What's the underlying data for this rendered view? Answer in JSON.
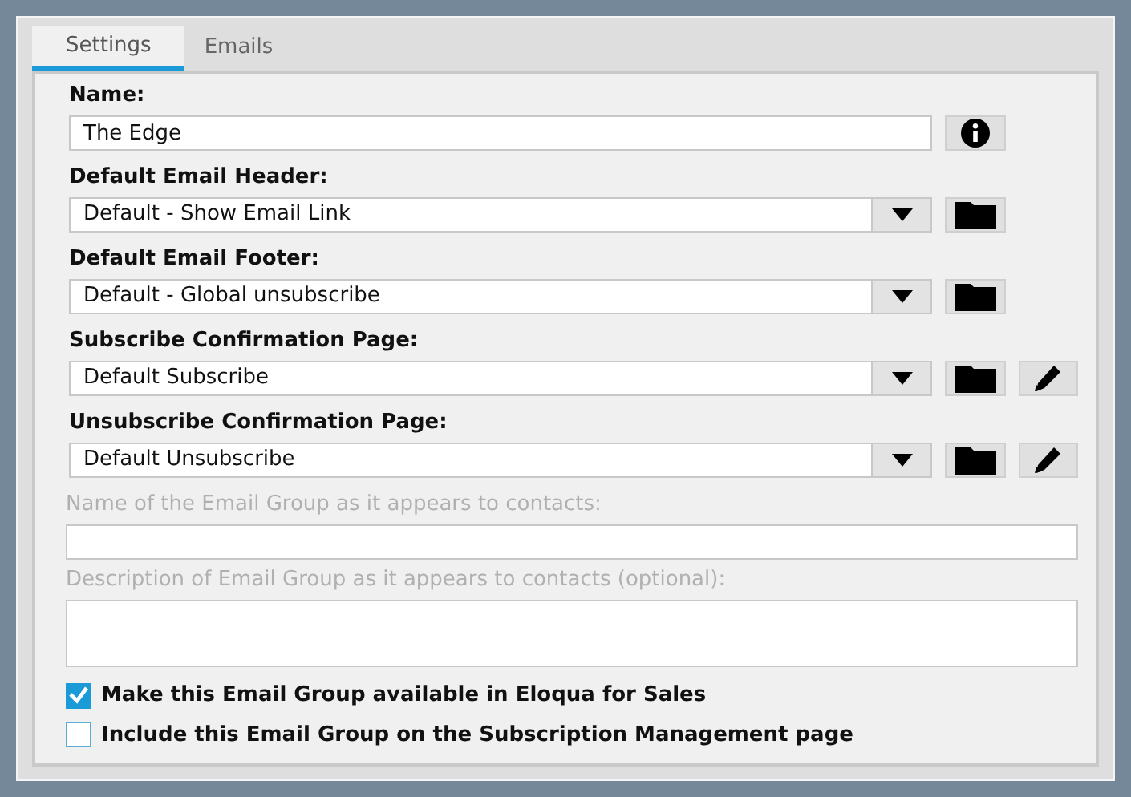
{
  "tabs": [
    {
      "label": "Settings",
      "selected": true
    },
    {
      "label": "Emails",
      "selected": false
    }
  ],
  "fields": [
    {
      "kind": "text",
      "label": "Name:",
      "value": "The Edge",
      "disabled": false,
      "buttons": [
        {
          "kind": "info"
        }
      ]
    },
    {
      "kind": "select",
      "label": "Default Email Header:",
      "value": "Default - Show Email Link",
      "disabled": false,
      "buttons": [
        {
          "kind": "folder"
        }
      ]
    },
    {
      "kind": "select",
      "label": "Default Email Footer:",
      "value": "Default - Global unsubscribe",
      "disabled": false,
      "buttons": [
        {
          "kind": "folder"
        }
      ]
    },
    {
      "kind": "select",
      "label": "Subscribe Confirmation Page:",
      "value": "Default Subscribe",
      "disabled": false,
      "buttons": [
        {
          "kind": "folder"
        },
        {
          "kind": "edit"
        }
      ]
    },
    {
      "kind": "select",
      "label": "Unsubscribe Confirmation Page:",
      "value": "Default Unsubscribe",
      "disabled": false,
      "buttons": [
        {
          "kind": "folder"
        },
        {
          "kind": "edit"
        }
      ]
    },
    {
      "kind": "text",
      "label": "Name of the Email Group as it appears to contacts:",
      "disabled": true
    },
    {
      "kind": "textarea",
      "label": "Description of Email Group as it appears to contacts (optional):",
      "disabled": true
    }
  ],
  "checkboxes": [
    {
      "label": "Make this Email Group available in Eloqua for Sales",
      "checked": true
    },
    {
      "label": "Include this Email Group on the Subscription Management page",
      "checked": false
    }
  ]
}
